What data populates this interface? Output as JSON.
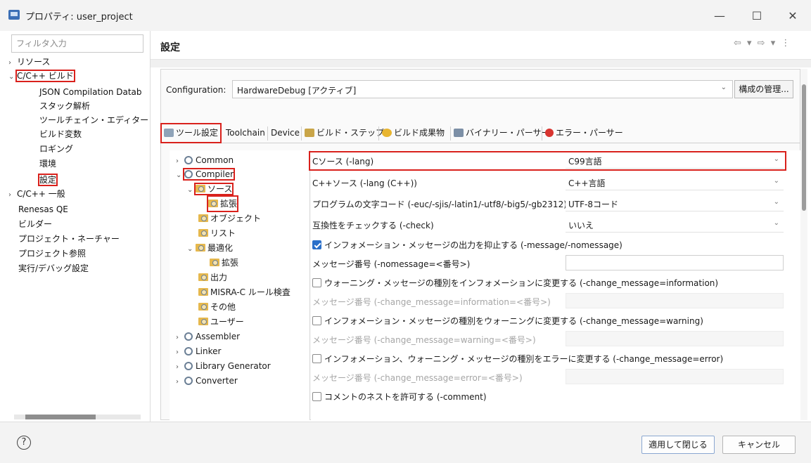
{
  "window": {
    "title": "プロパティ: user_project",
    "minimize": "—",
    "maximize": "☐",
    "close": "✕"
  },
  "filter": {
    "placeholder": "フィルタ入力"
  },
  "left_nav": {
    "items": [
      {
        "label": "リソース",
        "arrow": "›"
      },
      {
        "label": "C/C++ ビルド",
        "arrow": "⌄"
      },
      {
        "label": "JSON Compilation Datab"
      },
      {
        "label": "スタック解析"
      },
      {
        "label": "ツールチェイン・エディター"
      },
      {
        "label": "ビルド変数"
      },
      {
        "label": "ロギング"
      },
      {
        "label": "環境"
      },
      {
        "label": "設定"
      },
      {
        "label": "C/C++ 一般",
        "arrow": "›"
      },
      {
        "label": "Renesas QE"
      },
      {
        "label": "ビルダー"
      },
      {
        "label": "プロジェクト・ネーチャー"
      },
      {
        "label": "プロジェクト参照"
      },
      {
        "label": "実行/デバッグ設定"
      }
    ]
  },
  "header": {
    "title": "設定",
    "nav": "⇦ ▾ ⇨ ▾ ⋮"
  },
  "config": {
    "label": "Configuration:",
    "value": "HardwareDebug [アクティブ]",
    "manage_button": "構成の管理..."
  },
  "tabs": [
    {
      "label": "ツール設定"
    },
    {
      "label": "Toolchain"
    },
    {
      "label": "Device"
    },
    {
      "label": "ビルド・ステップ"
    },
    {
      "label": "ビルド成果物"
    },
    {
      "label": "バイナリー・パーサー"
    },
    {
      "label": "エラー・パーサー"
    }
  ],
  "tool_tree": {
    "common": "Common",
    "compiler": "Compiler",
    "source": "ソース",
    "extension": "拡張",
    "object": "オブジェクト",
    "list": "リスト",
    "optimize": "最適化",
    "opt_extension": "拡張",
    "output": "出力",
    "misra": "MISRA-C ルール検査",
    "other": "その他",
    "user": "ユーザー",
    "assembler": "Assembler",
    "linker": "Linker",
    "library": "Library Generator",
    "converter": "Converter"
  },
  "options": {
    "c_source_label": "Cソース (-lang)",
    "c_source_value": "C99言語",
    "cpp_source_label": "C++ソース (-lang (C++))",
    "cpp_source_value": "C++言語",
    "charcode_label": "プログラムの文字コード (-euc/-sjis/-latin1/-utf8/-big5/-gb2312)",
    "charcode_value": "UTF-8コード",
    "check_label": "互換性をチェックする (-check)",
    "check_value": "いいえ",
    "suppress_info_label": "インフォメーション・メッセージの出力を抑止する (-message/-nomessage)",
    "msg_no_label": "メッセージ番号 (-nomessage=<番号>)",
    "warn_to_info_label": "ウォーニング・メッセージの種別をインフォメーションに変更する (-change_message=information)",
    "warn_to_info_no_label": "メッセージ番号 (-change_message=information=<番号>)",
    "info_to_warn_label": "インフォメーション・メッセージの種別をウォーニングに変更する (-change_message=warning)",
    "info_to_warn_no_label": "メッセージ番号 (-change_message=warning=<番号>)",
    "to_error_label": "インフォメーション、ウォーニング・メッセージの種別をエラーに変更する (-change_message=error)",
    "to_error_no_label": "メッセージ番号 (-change_message=error=<番号>)",
    "nest_comment_label": "コメントのネストを許可する (-comment)"
  },
  "footer": {
    "help": "?",
    "apply": "適用して閉じる",
    "cancel": "キャンセル"
  },
  "colors": {
    "highlight": "#d9211c",
    "check_blue": "#2a6fc9"
  }
}
